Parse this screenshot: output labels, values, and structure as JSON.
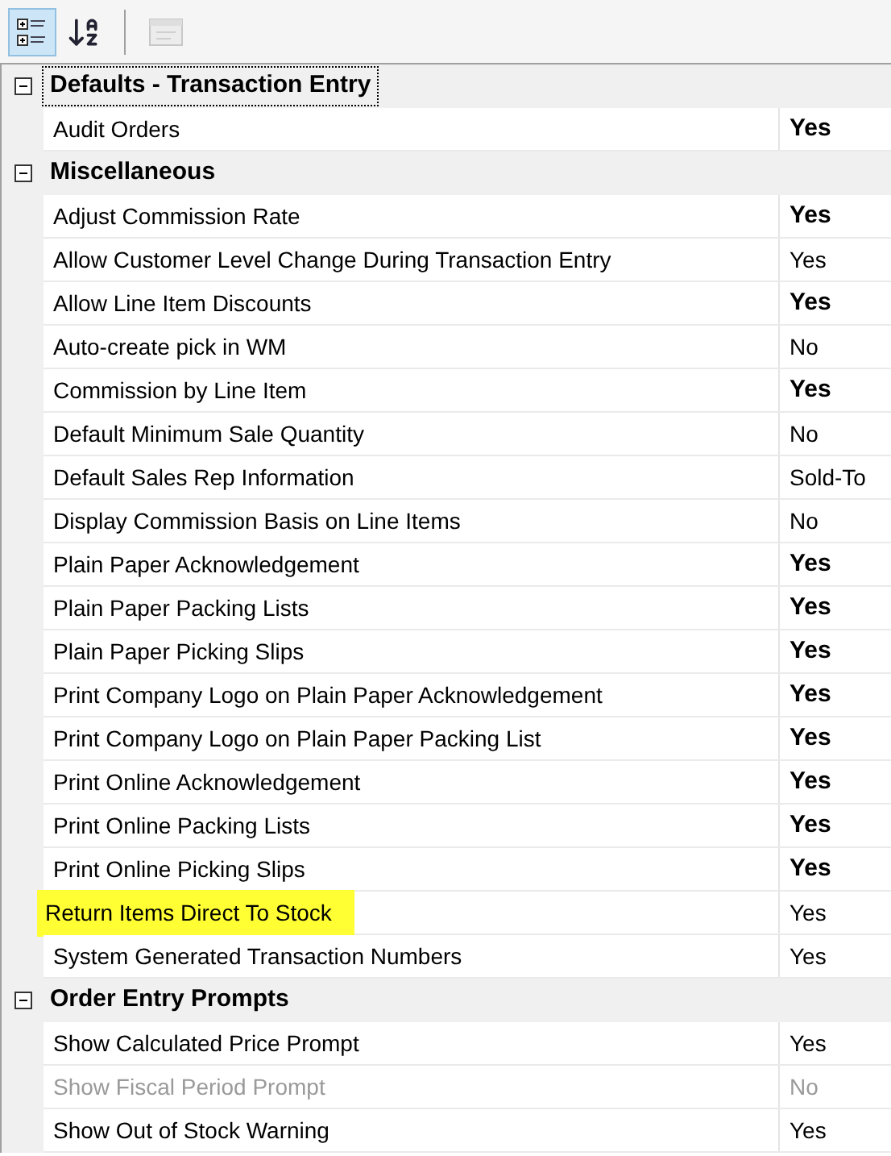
{
  "toolbar": [
    {
      "kind": "categorized",
      "selected": true,
      "disabled": false
    },
    {
      "kind": "alphabetical",
      "selected": false,
      "disabled": false
    },
    {
      "kind": "separator"
    },
    {
      "kind": "property_pages",
      "selected": false,
      "disabled": true
    }
  ],
  "categories": [
    {
      "title": "Defaults - Transaction Entry",
      "expanded": true,
      "focused": true,
      "properties": [
        {
          "name": "Audit Orders",
          "value": "Yes",
          "bold": true,
          "disabled": false,
          "highlighted": false
        }
      ]
    },
    {
      "title": "Miscellaneous",
      "expanded": true,
      "focused": false,
      "properties": [
        {
          "name": "Adjust Commission Rate",
          "value": "Yes",
          "bold": true,
          "disabled": false,
          "highlighted": false
        },
        {
          "name": "Allow Customer Level Change During Transaction Entry",
          "value": "Yes",
          "bold": false,
          "disabled": false,
          "highlighted": false
        },
        {
          "name": "Allow Line Item Discounts",
          "value": "Yes",
          "bold": true,
          "disabled": false,
          "highlighted": false
        },
        {
          "name": "Auto-create pick in WM",
          "value": "No",
          "bold": false,
          "disabled": false,
          "highlighted": false
        },
        {
          "name": "Commission by Line Item",
          "value": "Yes",
          "bold": true,
          "disabled": false,
          "highlighted": false
        },
        {
          "name": "Default Minimum Sale Quantity",
          "value": "No",
          "bold": false,
          "disabled": false,
          "highlighted": false
        },
        {
          "name": "Default Sales Rep Information",
          "value": "Sold-To",
          "bold": false,
          "disabled": false,
          "highlighted": false
        },
        {
          "name": "Display Commission Basis on Line Items",
          "value": "No",
          "bold": false,
          "disabled": false,
          "highlighted": false
        },
        {
          "name": "Plain Paper Acknowledgement",
          "value": "Yes",
          "bold": true,
          "disabled": false,
          "highlighted": false
        },
        {
          "name": "Plain Paper Packing Lists",
          "value": "Yes",
          "bold": true,
          "disabled": false,
          "highlighted": false
        },
        {
          "name": "Plain Paper Picking Slips",
          "value": "Yes",
          "bold": true,
          "disabled": false,
          "highlighted": false
        },
        {
          "name": "Print Company Logo on Plain Paper Acknowledgement",
          "value": "Yes",
          "bold": true,
          "disabled": false,
          "highlighted": false
        },
        {
          "name": "Print Company Logo on Plain Paper Packing List",
          "value": "Yes",
          "bold": true,
          "disabled": false,
          "highlighted": false
        },
        {
          "name": "Print Online Acknowledgement",
          "value": "Yes",
          "bold": true,
          "disabled": false,
          "highlighted": false
        },
        {
          "name": "Print Online Packing Lists",
          "value": "Yes",
          "bold": true,
          "disabled": false,
          "highlighted": false
        },
        {
          "name": "Print Online Picking Slips",
          "value": "Yes",
          "bold": true,
          "disabled": false,
          "highlighted": false
        },
        {
          "name": "Return Items Direct To Stock",
          "value": "Yes",
          "bold": false,
          "disabled": false,
          "highlighted": true
        },
        {
          "name": "System Generated Transaction Numbers",
          "value": "Yes",
          "bold": false,
          "disabled": false,
          "highlighted": false
        }
      ]
    },
    {
      "title": "Order Entry Prompts",
      "expanded": true,
      "focused": false,
      "properties": [
        {
          "name": "Show Calculated Price Prompt",
          "value": "Yes",
          "bold": false,
          "disabled": false,
          "highlighted": false
        },
        {
          "name": "Show Fiscal Period Prompt",
          "value": "No",
          "bold": false,
          "disabled": true,
          "highlighted": false
        },
        {
          "name": "Show Out of Stock Warning",
          "value": "Yes",
          "bold": false,
          "disabled": false,
          "highlighted": false
        }
      ]
    }
  ]
}
